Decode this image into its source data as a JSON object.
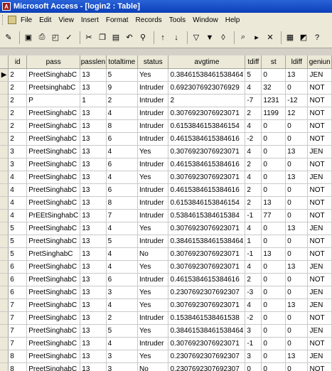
{
  "window": {
    "title": "Microsoft Access - [login2 : Table]"
  },
  "menu": [
    "File",
    "Edit",
    "View",
    "Insert",
    "Format",
    "Records",
    "Tools",
    "Window",
    "Help"
  ],
  "toolbar_icons": [
    "view-icon",
    "save-icon",
    "print-icon",
    "print-preview-icon",
    "spelling-icon",
    "cut-icon",
    "copy-icon",
    "paste-icon",
    "undo-icon",
    "insert-hyperlink-icon",
    "sort-ascending-icon",
    "sort-descending-icon",
    "filter-by-selection-icon",
    "filter-by-form-icon",
    "apply-filter-icon",
    "find-icon",
    "new-record-icon",
    "delete-record-icon",
    "database-window-icon",
    "new-object-icon",
    "help-icon"
  ],
  "table": {
    "columns": [
      "id",
      "pass",
      "passlen",
      "totaltime",
      "status",
      "avgtime",
      "tdiff",
      "st",
      "ldiff",
      "geniun"
    ],
    "rows": [
      [
        "2",
        "PreetSinghabC",
        "13",
        "5",
        "Yes",
        "0.38461538461538464",
        "5",
        "0",
        "13",
        "JEN"
      ],
      [
        "2",
        "PreetsinghabC",
        "13",
        "9",
        "Intruder",
        "0.6923076923076929",
        "4",
        "32",
        "0",
        "NOT"
      ],
      [
        "2",
        "P",
        "1",
        "2",
        "Intruder",
        "2",
        "-7",
        "1231",
        "-12",
        "NOT"
      ],
      [
        "2",
        "PreetSinghabC",
        "13",
        "4",
        "Intruder",
        "0.3076923076923071",
        "2",
        "1199",
        "12",
        "NOT"
      ],
      [
        "2",
        "PreetSinghabC",
        "13",
        "8",
        "Intruder",
        "0.6153846153846154",
        "4",
        "0",
        "0",
        "NOT"
      ],
      [
        "2",
        "PreetSinghabC",
        "13",
        "6",
        "Intruder",
        "0.4615384615384616",
        "-2",
        "0",
        "0",
        "NOT"
      ],
      [
        "3",
        "PreetSinghabC",
        "13",
        "4",
        "Yes",
        "0.3076923076923071",
        "4",
        "0",
        "13",
        "JEN"
      ],
      [
        "3",
        "PreetSinghabC",
        "13",
        "6",
        "Intruder",
        "0.4615384615384616",
        "2",
        "0",
        "0",
        "NOT"
      ],
      [
        "4",
        "PreetSinghabC",
        "13",
        "4",
        "Yes",
        "0.3076923076923071",
        "4",
        "0",
        "13",
        "JEN"
      ],
      [
        "4",
        "PreetSinghabC",
        "13",
        "6",
        "Intruder",
        "0.4615384615384616",
        "2",
        "0",
        "0",
        "NOT"
      ],
      [
        "4",
        "PreetSinghabC",
        "13",
        "8",
        "Intruder",
        "0.6153846153846154",
        "2",
        "13",
        "0",
        "NOT"
      ],
      [
        "4",
        "PrEEtSinghabC",
        "13",
        "7",
        "Intruder",
        "0.5384615384615384",
        "-1",
        "77",
        "0",
        "NOT"
      ],
      [
        "5",
        "PreetSinghabC",
        "13",
        "4",
        "Yes",
        "0.3076923076923071",
        "4",
        "0",
        "13",
        "JEN"
      ],
      [
        "5",
        "PreetSinghabC",
        "13",
        "5",
        "Intruder",
        "0.38461538461538464",
        "1",
        "0",
        "0",
        "NOT"
      ],
      [
        "5",
        "PretSinghabC",
        "13",
        "4",
        "No",
        "0.3076923076923071",
        "-1",
        "13",
        "0",
        "NOT"
      ],
      [
        "6",
        "PreetSinghabC",
        "13",
        "4",
        "Yes",
        "0.3076923076923071",
        "4",
        "0",
        "13",
        "JEN"
      ],
      [
        "6",
        "PreetSinghabC",
        "13",
        "6",
        "Intruder",
        "0.4615384615384616",
        "2",
        "0",
        "0",
        "NOT"
      ],
      [
        "6",
        "PreetSinghabC",
        "13",
        "3",
        "Yes",
        "0.2307692307692307",
        "-3",
        "0",
        "0",
        "JEN"
      ],
      [
        "7",
        "PreetSinghabC",
        "13",
        "4",
        "Yes",
        "0.3076923076923071",
        "4",
        "0",
        "13",
        "JEN"
      ],
      [
        "7",
        "PreetSinghabC",
        "13",
        "2",
        "Intruder",
        "0.1538461538461538",
        "-2",
        "0",
        "0",
        "NOT"
      ],
      [
        "7",
        "PreetSinghabC",
        "13",
        "5",
        "Yes",
        "0.38461538461538464",
        "3",
        "0",
        "0",
        "JEN"
      ],
      [
        "7",
        "PreetSinghabC",
        "13",
        "4",
        "Intruder",
        "0.3076923076923071",
        "-1",
        "0",
        "0",
        "NOT"
      ],
      [
        "8",
        "PreetSinghabC",
        "13",
        "3",
        "Yes",
        "0.2307692307692307",
        "3",
        "0",
        "13",
        "JEN"
      ],
      [
        "8",
        "PreetSinghabC",
        "13",
        "3",
        "No",
        "0.2307692307692307",
        "0",
        "0",
        "0",
        "NOT"
      ]
    ]
  }
}
